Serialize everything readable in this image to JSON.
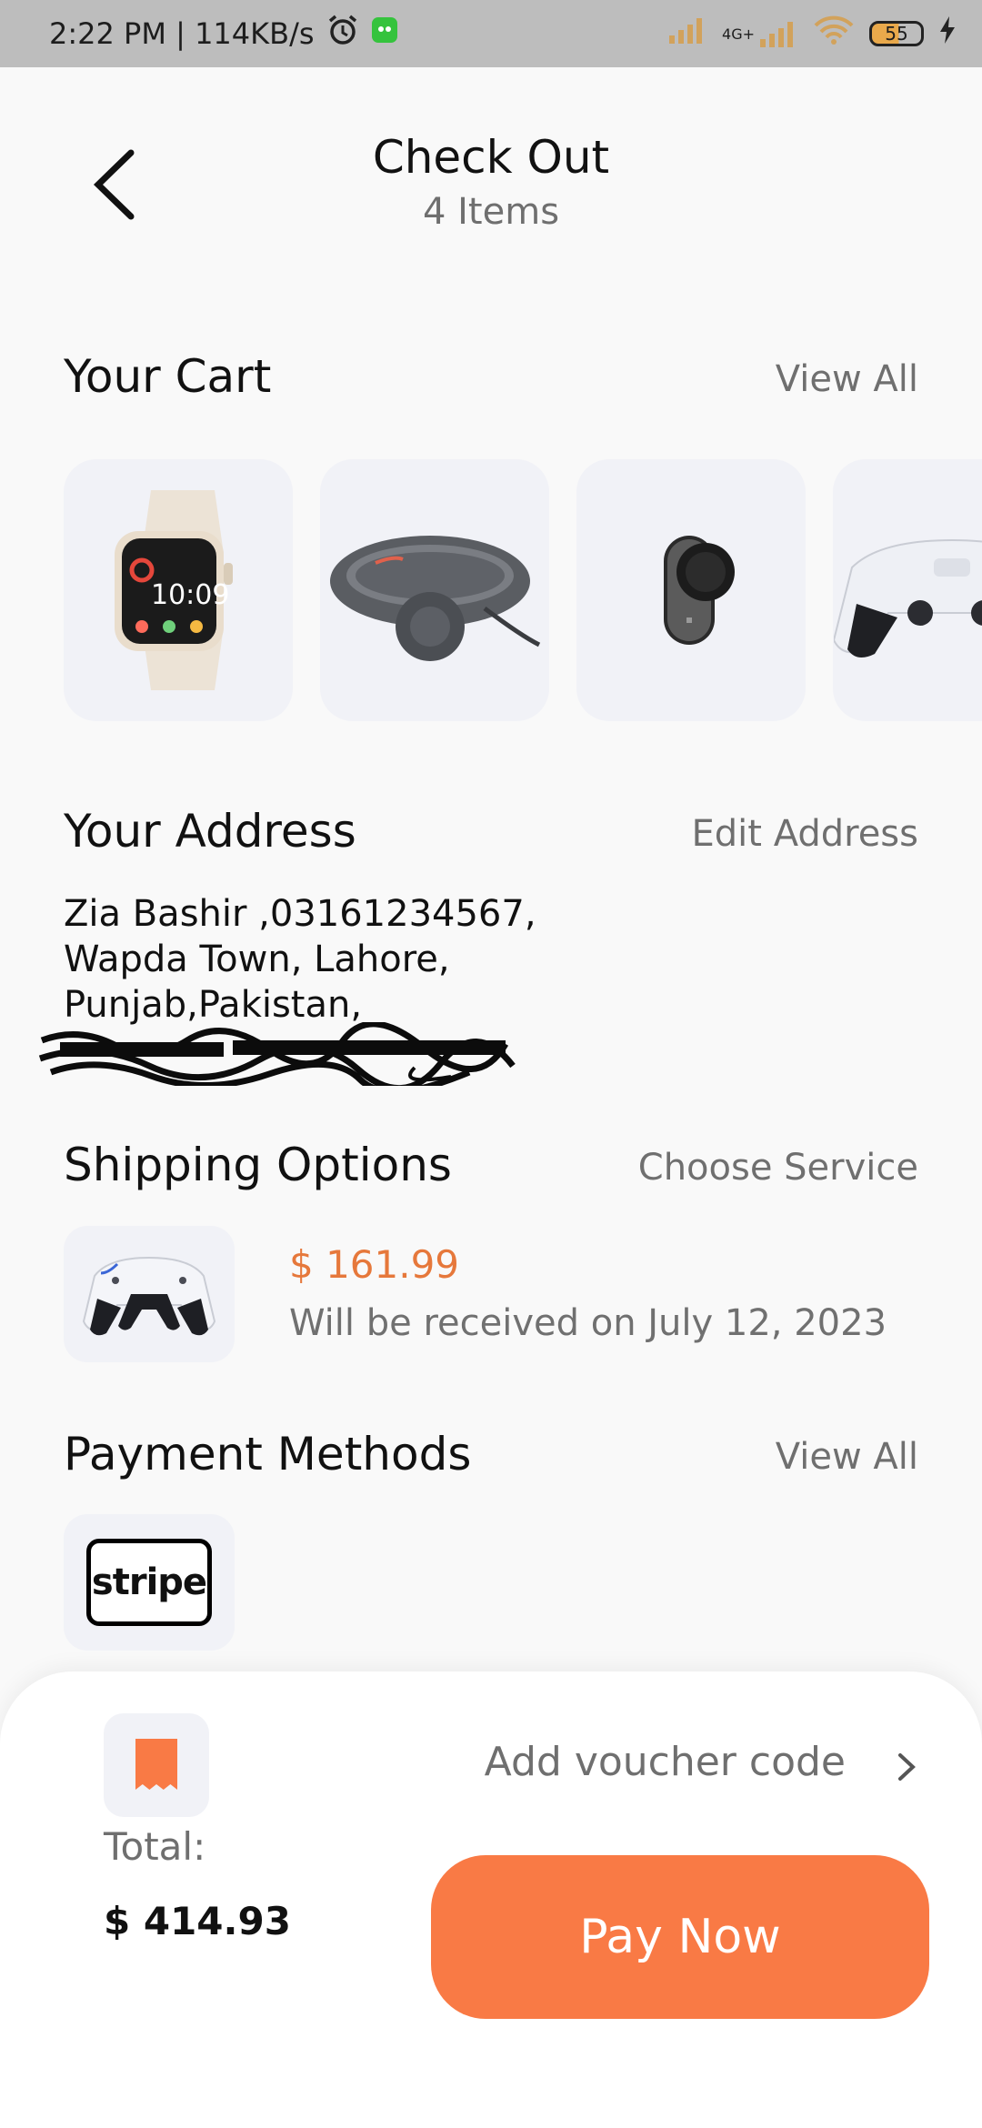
{
  "status_bar": {
    "time_speed": "2:22 PM | 114KB/s",
    "network": "4G+",
    "battery": "55"
  },
  "header": {
    "title": "Check Out",
    "subtitle": "4 Items"
  },
  "cart": {
    "title": "Your Cart",
    "link": "View All",
    "watch_time": "10:09",
    "items": [
      "smart-watch",
      "headphones",
      "remote-device",
      "game-controller"
    ]
  },
  "address": {
    "title": "Your Address",
    "link": "Edit Address",
    "line1": "Zia Bashir ,03161234567,",
    "line2": "Wapda Town, Lahore,",
    "line3": "Punjab,Pakistan,"
  },
  "shipping": {
    "title": "Shipping Options",
    "link": "Choose Service",
    "price": "$ 161.99",
    "delivery": "Will be received on July 12, 2023"
  },
  "payment": {
    "title": "Payment Methods",
    "link": "View All",
    "method": "stripe"
  },
  "checkout": {
    "voucher": "Add voucher code",
    "total_label": "Total:",
    "total_value": "$ 414.93",
    "pay_button": "Pay Now"
  },
  "colors": {
    "accent": "#f97a45",
    "price": "#e6783b",
    "card_bg": "#f1f2f7"
  }
}
